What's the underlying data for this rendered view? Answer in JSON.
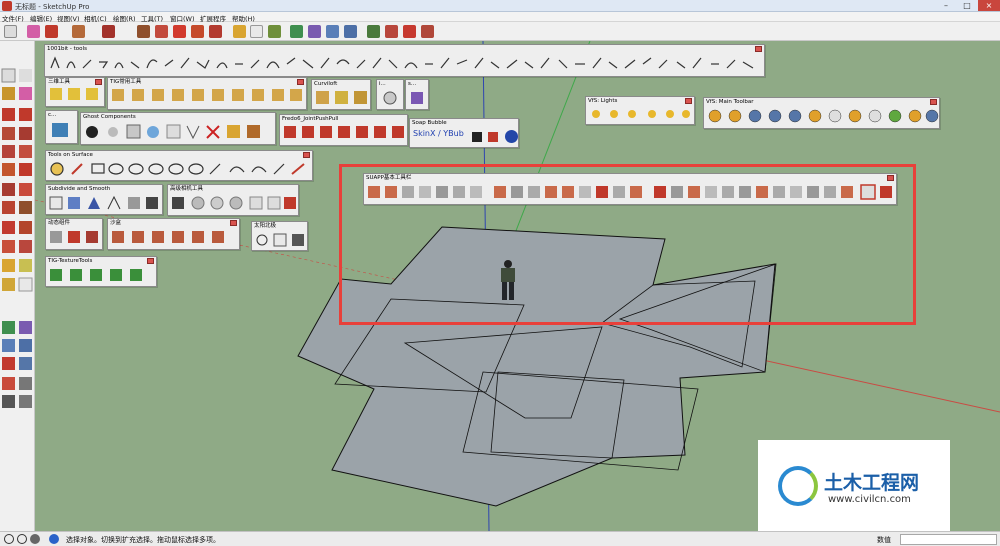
{
  "window": {
    "title": "无标题 - SketchUp Pro"
  },
  "menu": [
    "文件(F)",
    "编辑(E)",
    "视图(V)",
    "相机(C)",
    "绘图(R)",
    "工具(T)",
    "窗口(W)",
    "扩展程序",
    "帮助(H)"
  ],
  "colors": {
    "accent_red": "#e8403a",
    "viewport_green": "#8faa86",
    "face_gray": "#9ba3a9"
  },
  "panels": {
    "p1001bit": "1001bit - tools",
    "sanwei": "三维工具",
    "tigcy": "TIG常用工具",
    "curviloft": "Curviloft",
    "small_i": "i...",
    "small_s": "s...",
    "small_c": "c...",
    "ghost": "Ghost Components",
    "fredo": "Fredo6_JointPushPull",
    "soap": "Soap Bubble",
    "soap_btn": "SkinX / YBub",
    "tools_surface": "Tools on Surface",
    "subdivide": "Subdivide and Smooth",
    "gaoji": "高级相机工具",
    "dongtai": "动态组件",
    "shapan": "沙盒",
    "taiyang": "太阳北极",
    "tig_tex": "TIG-TextureTools",
    "vfs_lights": "VfS: Lights",
    "vfs_main": "VfS: Main Toolbar",
    "suapp": "SUAPP基本工具栏"
  },
  "status": {
    "text": "选择对象。切换到扩充选择。拖动鼠标选择多项。",
    "measure_label": "数值",
    "measure_value": ""
  },
  "watermark": {
    "title": "土木工程网",
    "url": "www.civilcn.com"
  }
}
